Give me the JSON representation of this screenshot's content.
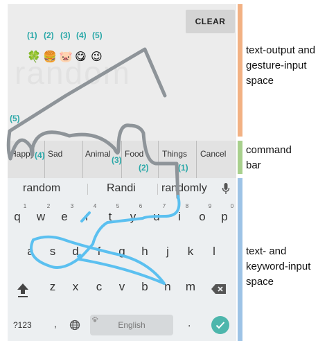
{
  "output": {
    "clear_label": "CLEAR",
    "ghost_word": "random",
    "numbers": [
      "(1)",
      "(2)",
      "(3)",
      "(4)",
      "(5)"
    ],
    "emojis": [
      "🍀",
      "🍔",
      "🐷",
      "😋",
      "😉"
    ],
    "gesture_number": "(5)"
  },
  "commands": {
    "items": [
      "Happy",
      "Sad",
      "Animal",
      "Food",
      "Things",
      "Cancel"
    ],
    "markers": [
      "(4)",
      "(3)",
      "(2)",
      "(1)"
    ]
  },
  "keyboard": {
    "suggestions": [
      "random",
      "Randi",
      "randomly"
    ],
    "row1": [
      "q",
      "w",
      "e",
      "r",
      "t",
      "y",
      "u",
      "i",
      "o",
      "p"
    ],
    "row1_hints": [
      "1",
      "2",
      "3",
      "4",
      "5",
      "6",
      "7",
      "8",
      "9",
      "0"
    ],
    "row2": [
      "a",
      "s",
      "d",
      "f",
      "g",
      "h",
      "j",
      "k",
      "l"
    ],
    "row3": [
      "z",
      "x",
      "c",
      "v",
      "b",
      "n",
      "m"
    ],
    "symbols_label": "?123",
    "comma_label": ",",
    "period_label": ".",
    "space_label": "English",
    "icons": {
      "mic": "microphone-icon",
      "shift": "shift-icon",
      "backspace": "backspace-icon",
      "globe": "globe-icon",
      "enter": "checkmark-icon"
    }
  },
  "annotations": {
    "output_label": "text-output and gesture-input space",
    "command_label": "command bar",
    "keyboard_label": "text- and keyword-input space",
    "colors": {
      "output": "#f2b183",
      "command": "#a8d08d",
      "keyboard": "#9dc3e6",
      "accent": "#2aa8a8",
      "gesture_gray": "#8e9499",
      "gesture_blue": "#5bc0f0"
    }
  }
}
